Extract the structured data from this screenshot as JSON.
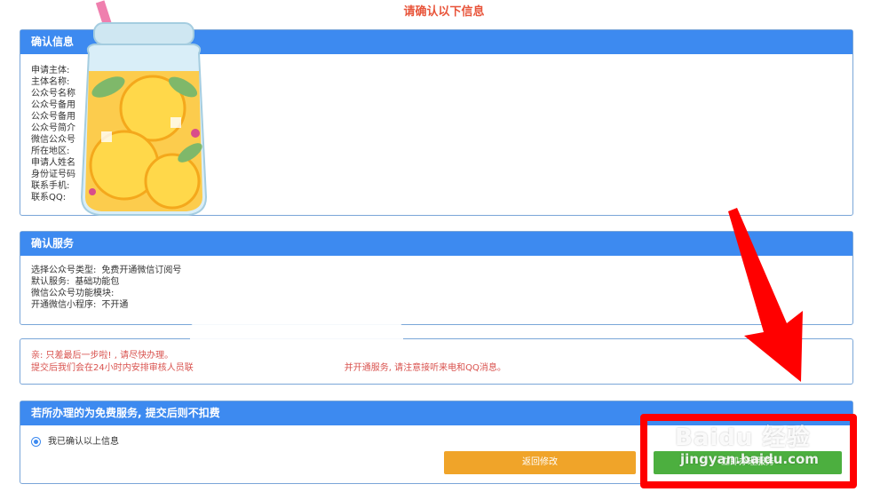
{
  "page": {
    "title": "请确认以下信息"
  },
  "confirm_info": {
    "header": "确认信息",
    "fields": [
      "申请主体:",
      "主体名称:",
      "公众号名称",
      "公众号备用",
      "公众号备用",
      "公众号简介",
      "微信公众号",
      "所在地区:",
      "申请人姓名",
      "身份证号码",
      "联系手机:",
      "联系QQ:"
    ]
  },
  "confirm_service": {
    "header": "确认服务",
    "rows": [
      {
        "label": "选择公众号类型:",
        "value": "免费开通微信订阅号"
      },
      {
        "label": "默认服务:",
        "value": "基础功能包"
      },
      {
        "label": "微信公众号功能模块:",
        "value": ""
      },
      {
        "label": "开通微信小程序:",
        "value": "不开通"
      }
    ]
  },
  "notice": {
    "line1": "亲: 只差最后一步啦! , 请尽快办理。",
    "line2_start": "提交后我们会在24小时内安排审核人员联",
    "line2_end": "并开通服务, 请注意接听来电和QQ消息。"
  },
  "submit": {
    "header": "若所办理的为免费服务, 提交后则不扣费",
    "confirm_checkbox": "我已确认以上信息",
    "back_button": "返回修改",
    "submit_button": "立即办理服务"
  },
  "watermark": {
    "brand": "Baidu 经验",
    "url": "jingyan.baidu.com"
  },
  "colors": {
    "accent": "#3d8af0",
    "title": "#e8553b",
    "warn": "#d9534f",
    "back": "#f0a429",
    "go": "#4caf3f",
    "annotation": "#ff0000"
  }
}
